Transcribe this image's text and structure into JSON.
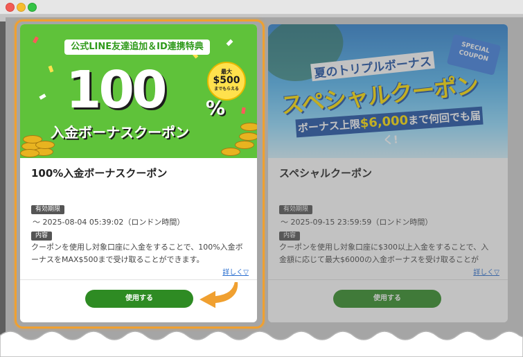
{
  "window": {
    "title": ""
  },
  "cards": [
    {
      "banner": {
        "pill": "公式LINE友達追加＆ID連携特典",
        "big": "100",
        "percent": "%",
        "sub": "入金ボーナスクーポン",
        "badge_l1": "最大",
        "badge_l2": "$500",
        "badge_l3": "までもらえる"
      },
      "title": "100%入金ボーナスクーポン",
      "period_label": "有効期限",
      "period": "〜 2025-08-04 05:39:02（ロンドン時間）",
      "content_label": "内容",
      "description": "クーポンを使用し対象口座に入金をすることで、100%入金ボーナスをMAX$500まで受け取ることができます。",
      "more": "詳しく▽",
      "button": "使用する"
    },
    {
      "banner": {
        "title1": "夏のトリプルボーナス",
        "title2": "スペシャルクーポン",
        "title3_pre": "ボーナス上限",
        "title3_amt": "$6,000",
        "title3_post": "まで何回でも届く!",
        "ticket": "SPECIAL COUPON"
      },
      "title": "スペシャルクーポン",
      "period_label": "有効期限",
      "period": "〜 2025-09-15 23:59:59（ロンドン時間）",
      "content_label": "内容",
      "description": "クーポンを使用し対象口座に$300以上入金をすることで、入金額に応じて最大$6000の入金ボーナスを受け取ることが",
      "more": "詳しく▽",
      "button": "使用する"
    }
  ],
  "colors": {
    "accent": "#2e8b23",
    "highlight": "#f0a030",
    "banner1": "#5fc23a",
    "banner2": "#54b6f0"
  },
  "icons": [
    "close-dot",
    "minimize-dot",
    "zoom-dot",
    "pointing-arrow-icon"
  ]
}
